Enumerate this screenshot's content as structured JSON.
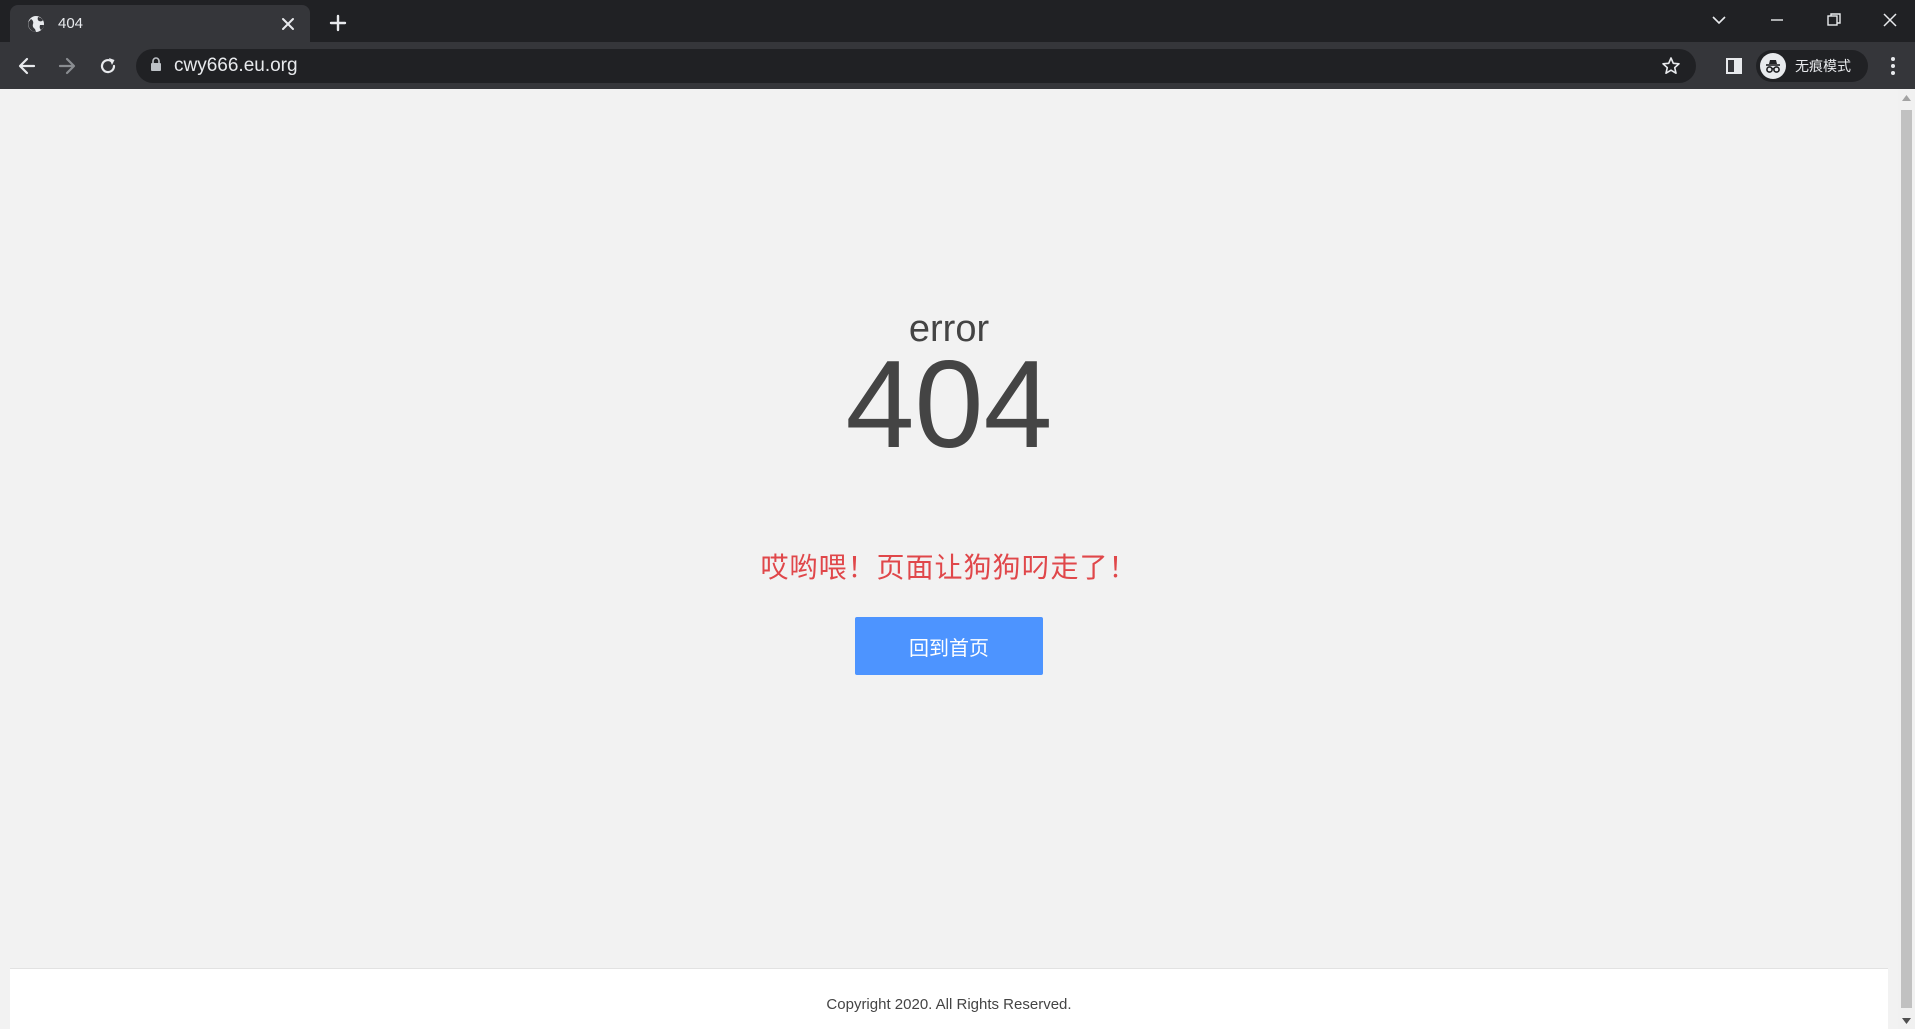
{
  "browser": {
    "tab_title": "404",
    "url": "cwy666.eu.org",
    "incognito_label": "无痕模式"
  },
  "page": {
    "error_word": "error",
    "error_code": "404",
    "message": "哎哟喂！页面让狗狗叼走了！",
    "home_button_label": "回到首页",
    "copyright": "Copyright 2020. All Rights Reserved."
  },
  "colors": {
    "message": "#e0474a",
    "button": "#4d94ff",
    "page_background": "#f2f2f2",
    "chrome_dark": "#202124",
    "chrome_toolbar": "#35363a"
  },
  "icons": {
    "favicon": "globe-icon",
    "tab_close": "close-icon",
    "new_tab": "plus-icon",
    "back": "back-arrow-icon",
    "forward": "forward-arrow-icon",
    "reload": "reload-icon",
    "lock": "lock-icon",
    "bookmark": "star-icon",
    "side_panel": "side-panel-icon",
    "incognito": "incognito-icon",
    "menu": "kebab-menu-icon"
  }
}
